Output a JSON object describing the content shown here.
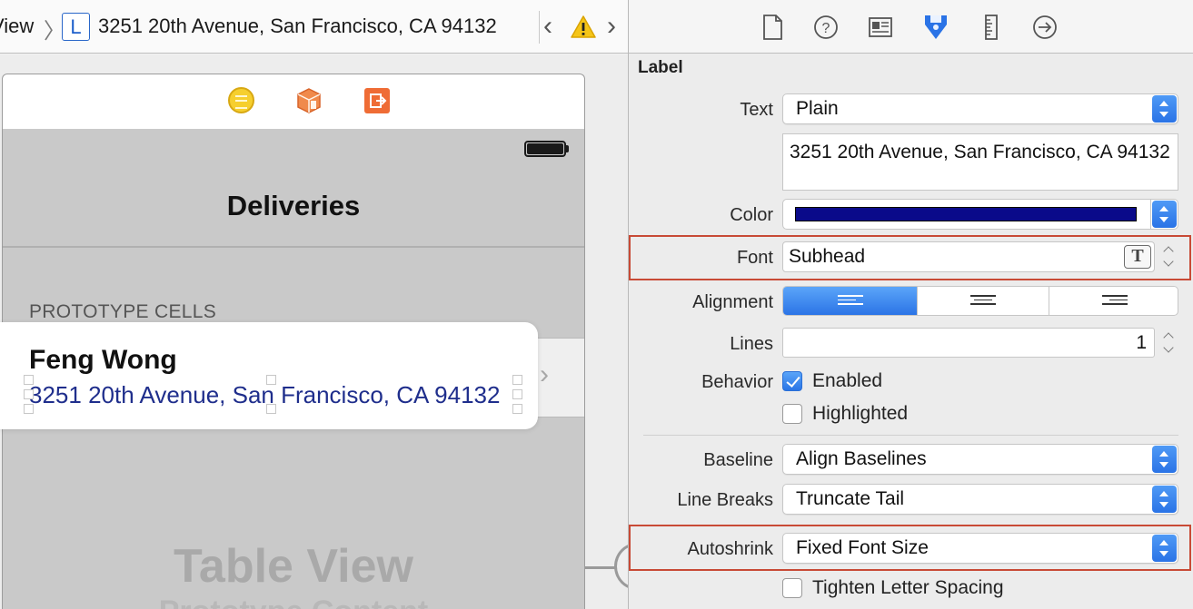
{
  "breadcrumb": {
    "view_fragment": "View",
    "label_icon_letter": "L",
    "label_title": "3251 20th Avenue, San Francisco, CA 94132"
  },
  "scene": {
    "nav_title": "Deliveries",
    "section_header": "PROTOTYPE CELLS",
    "cell": {
      "title": "Feng Wong",
      "subtitle": "3251 20th Avenue, San Francisco, CA 94132"
    },
    "overlay_text": "Table View",
    "overlay_text_2": "Prototype Content"
  },
  "inspector": {
    "section_title": "Label",
    "text": {
      "label": "Text",
      "type_value": "Plain",
      "content": "3251 20th Avenue, San Francisco, CA 94132"
    },
    "color": {
      "label": "Color",
      "value_hex": "#0a0a8a"
    },
    "font": {
      "label": "Font",
      "value": "Subhead",
      "picker_glyph": "T"
    },
    "alignment": {
      "label": "Alignment",
      "selected": "left"
    },
    "lines": {
      "label": "Lines",
      "value": "1"
    },
    "behavior": {
      "label": "Behavior",
      "enabled": {
        "label": "Enabled",
        "checked": true
      },
      "highlighted": {
        "label": "Highlighted",
        "checked": false
      }
    },
    "baseline": {
      "label": "Baseline",
      "value": "Align Baselines"
    },
    "line_breaks": {
      "label": "Line Breaks",
      "value": "Truncate Tail"
    },
    "autoshrink": {
      "label": "Autoshrink",
      "value": "Fixed Font Size"
    },
    "tighten": {
      "label": "Tighten Letter Spacing",
      "checked": false
    }
  },
  "colors": {
    "accent": "#2a73e6",
    "highlight_border": "#c84a36",
    "subtitle_text": "#1f2e8c"
  }
}
